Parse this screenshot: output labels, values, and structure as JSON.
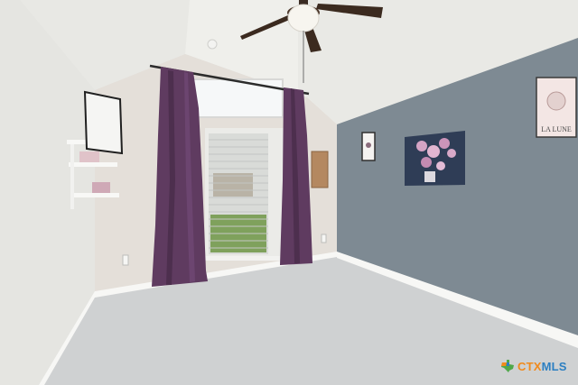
{
  "scene": {
    "colors": {
      "ceiling": "#eeeeea",
      "left_wall": "#e6e6e2",
      "back_wall": "#e2ddd7",
      "accent_wall": "#7d8a94",
      "floor": "#cfd1d1",
      "curtain": "#5e3a5f",
      "baseboard": "#f6f6f4"
    },
    "objects": [
      "ceiling-fan",
      "window-with-blinds",
      "purple-curtains",
      "wall-shelf",
      "framed-picture",
      "flower-painting",
      "small-frame",
      "cork-board",
      "moon-print"
    ]
  },
  "artwork": {
    "moon_print_text": "LA LUNE"
  },
  "watermark": {
    "ctx": "CTX",
    "mls": "MLS"
  }
}
